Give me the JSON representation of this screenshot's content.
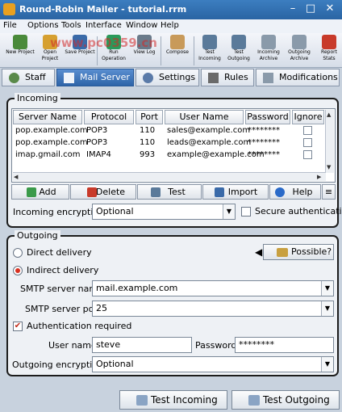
{
  "window": {
    "title": "Round-Robin Mailer - tutorial.rrm"
  },
  "menu": [
    "File",
    "Options",
    "Tools",
    "Interface",
    "Window",
    "Help"
  ],
  "toolbar": [
    {
      "label": "New Project",
      "icon": "new-project-icon",
      "color": "#4a8a3a"
    },
    {
      "label": "Open Project",
      "icon": "open-project-icon",
      "color": "#d6a030"
    },
    {
      "label": "Save Project",
      "icon": "save-project-icon",
      "color": "#3a6aa8"
    },
    {
      "label": "Run Operation",
      "icon": "run-operation-icon",
      "color": "#2a9a5a"
    },
    {
      "label": "View Log",
      "icon": "view-log-icon",
      "color": "#6a7a8a"
    },
    {
      "label": "Compose",
      "icon": "compose-icon",
      "color": "#c89a5a"
    },
    {
      "label": "Test Incoming",
      "icon": "test-incoming-icon",
      "color": "#5a7a9a"
    },
    {
      "label": "Test Outgoing",
      "icon": "test-outgoing-icon",
      "color": "#5a7a9a"
    },
    {
      "label": "Incoming Archive",
      "icon": "incoming-archive-icon",
      "color": "#8a9aaa"
    },
    {
      "label": "Outgoing Archive",
      "icon": "outgoing-archive-icon",
      "color": "#8a9aaa"
    },
    {
      "label": "Report Stats",
      "icon": "report-stats-icon",
      "color": "#c83a2a"
    }
  ],
  "tabs": [
    {
      "label": "Staff",
      "icon": "staff-icon"
    },
    {
      "label": "Mail Server",
      "icon": "mail-server-icon"
    },
    {
      "label": "Settings",
      "icon": "settings-icon"
    },
    {
      "label": "Rules",
      "icon": "rules-icon"
    },
    {
      "label": "Modifications",
      "icon": "modifications-icon"
    }
  ],
  "incoming": {
    "title": "Incoming",
    "columns": [
      "Server Name",
      "Protocol",
      "Port",
      "User Name",
      "Password",
      "Ignore"
    ],
    "rows": [
      [
        "pop.example.com",
        "POP3",
        "110",
        "sales@example.com",
        "********"
      ],
      [
        "pop.example.com",
        "POP3",
        "110",
        "leads@example.com",
        "********"
      ],
      [
        "imap.gmail.com",
        "IMAP4",
        "993",
        "example@example.com",
        "********"
      ]
    ],
    "buttons": [
      "Add",
      "Delete",
      "Test",
      "Import",
      "Help"
    ],
    "encryption_label": "Incoming encryption:",
    "encryption_value": "Optional",
    "secure_auth_label": "Secure authentication"
  },
  "outgoing": {
    "title": "Outgoing",
    "direct_label": "Direct delivery",
    "indirect_label": "Indirect delivery",
    "possible_label": "Possible?",
    "smtp_name_label": "SMTP server name:",
    "smtp_name_value": "mail.example.com",
    "smtp_port_label": "SMTP server port:",
    "smtp_port_value": "25",
    "auth_label": "Authentication required",
    "user_label": "User name:",
    "user_value": "steve",
    "password_label": "Password:",
    "password_value": "********",
    "encryption_label": "Outgoing encryption:",
    "encryption_value": "Optional"
  },
  "footer": {
    "test_incoming": "Test Incoming",
    "test_outgoing": "Test Outgoing"
  },
  "watermark": "www.pc0359.cn"
}
